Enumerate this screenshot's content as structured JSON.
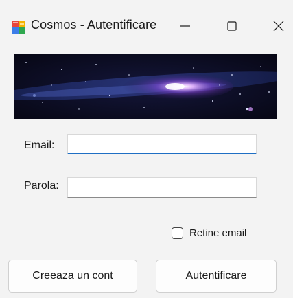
{
  "window": {
    "title": "Cosmos - Autentificare",
    "icon": "windows-form-icon",
    "controls": {
      "minimize_icon": "minimize-icon",
      "maximize_icon": "maximize-icon",
      "close_icon": "close-icon"
    }
  },
  "banner": {
    "image": "galaxy-banner"
  },
  "form": {
    "email_label": "Email:",
    "email_value": "",
    "parola_label": "Parola:",
    "parola_value": "",
    "remember_label": "Retine email",
    "remember_checked": false
  },
  "buttons": {
    "create_account": "Creeaza un cont",
    "login": "Autentificare"
  },
  "colors": {
    "background": "#f3f3f3",
    "focus_accent": "#1f6fc4"
  }
}
